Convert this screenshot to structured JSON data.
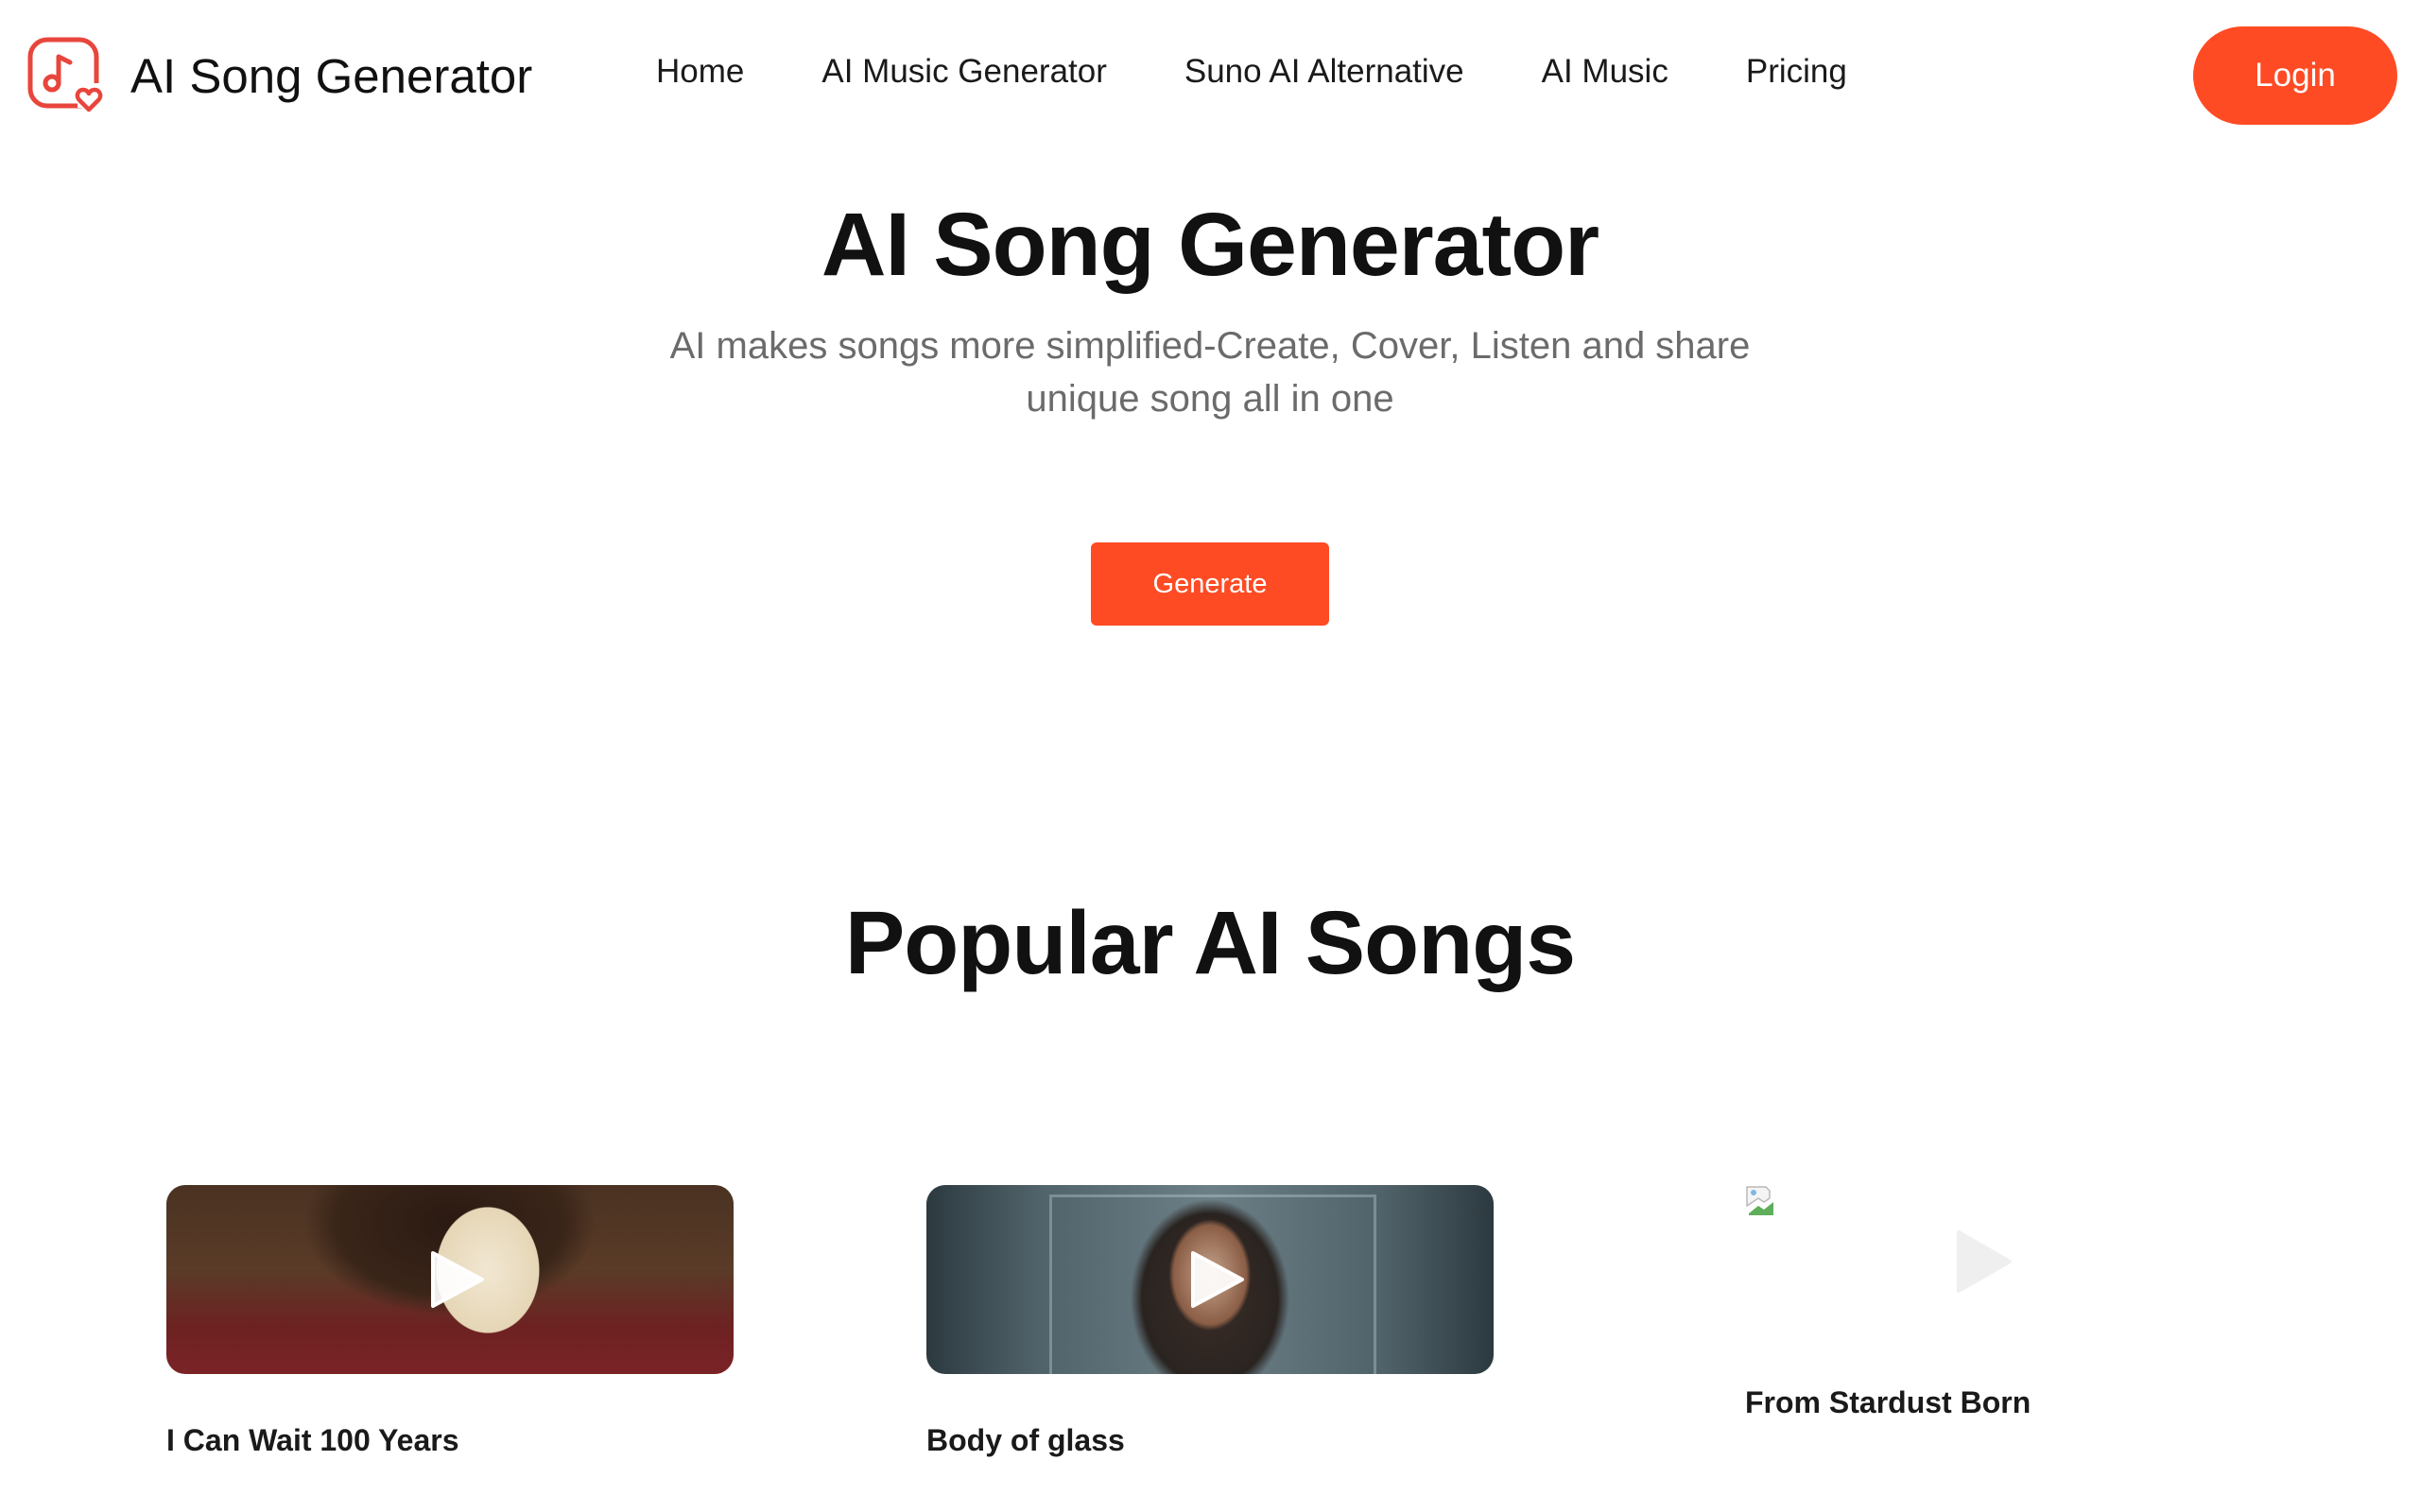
{
  "header": {
    "logo_text": "AI Song Generator",
    "nav": [
      {
        "label": "Home"
      },
      {
        "label": "AI Music Generator"
      },
      {
        "label": "Suno AI Alternative"
      },
      {
        "label": "AI Music"
      },
      {
        "label": "Pricing"
      }
    ],
    "login_label": "Login"
  },
  "hero": {
    "title": "AI Song Generator",
    "subtitle": "AI makes songs more simplified-Create, Cover, Listen and share unique song all in one",
    "generate_label": "Generate"
  },
  "popular": {
    "title": "Popular AI Songs",
    "songs": [
      {
        "title": "I Can Wait 100 Years",
        "icon": "play-icon"
      },
      {
        "title": "Body of glass",
        "icon": "play-icon"
      },
      {
        "title": "From Stardust Born",
        "icon": "play-icon"
      }
    ]
  },
  "colors": {
    "accent": "#ff4b24",
    "logo_red": "#e8453c",
    "text": "#111111",
    "muted": "#6b6b6b"
  },
  "icons": [
    "music-note-heart-logo-icon",
    "play-icon",
    "broken-image-icon"
  ]
}
